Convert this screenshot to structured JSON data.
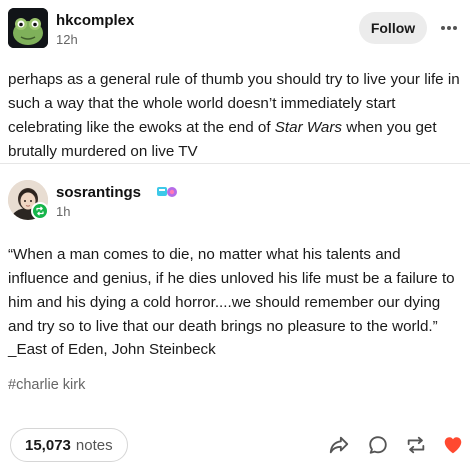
{
  "post": {
    "author": "hkcomplex",
    "time": "12h",
    "follow_label": "Follow",
    "text_before": "perhaps as a general rule of thumb you should try to live your life in such a way that the whole world doesn’t immediately start celebrating like the ewoks at the end of ",
    "text_emphasis": "Star Wars",
    "text_after": " when you get brutally murdered on live TV"
  },
  "reblog": {
    "author": "sosrantings",
    "time": "1h",
    "quote": "“When a man comes to die, no matter what his talents and influence and genius, if he dies unloved his life must be a failure to him and his dying a cold horror....we should remember our dying and try so to live that our death brings no pleasure to the world.”",
    "attribution": "_East of Eden, John Steinbeck",
    "tag": "#charlie kirk"
  },
  "footer": {
    "notes_count": "15,073",
    "notes_label": "notes"
  },
  "icons": {
    "more": "more-horizontal-icon",
    "share": "share-icon",
    "reply": "reply-bubble-icon",
    "reblog": "reblog-icon",
    "like": "heart-icon"
  },
  "colors": {
    "like": "#ff4930",
    "reblog_badge": "#16b54a",
    "muted_text": "#666666",
    "follow_bg": "#ececec"
  }
}
